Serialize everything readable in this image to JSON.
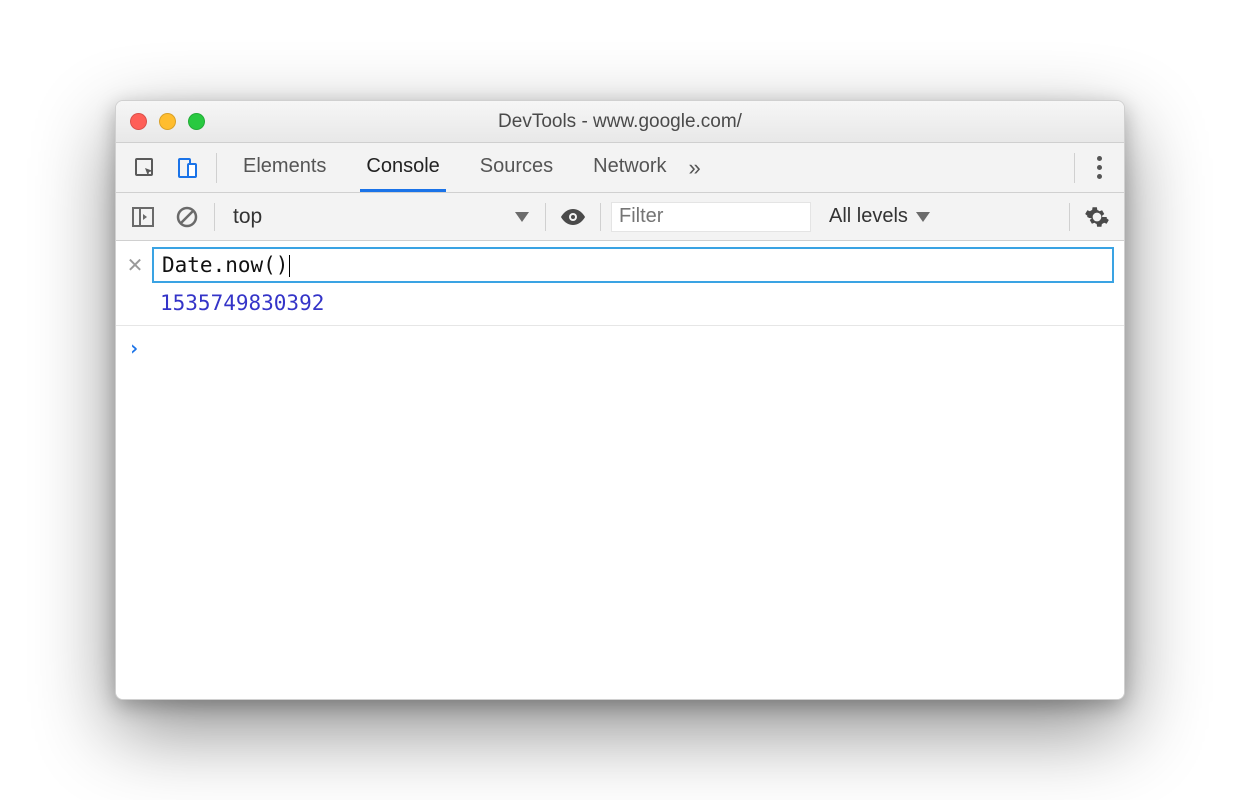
{
  "window": {
    "title": "DevTools - www.google.com/"
  },
  "tabs": {
    "items": [
      "Elements",
      "Console",
      "Sources",
      "Network"
    ],
    "active": "Console",
    "overflow_glyph": "»"
  },
  "subbar": {
    "context": "top",
    "filter_placeholder": "Filter",
    "filter_value": "",
    "levels_label": "All levels"
  },
  "console": {
    "live_expression": "Date.now()",
    "live_result": "1535749830392",
    "prompt_value": ""
  },
  "icons": {
    "inspect": "inspect-icon",
    "device": "device-icon",
    "sidebar": "sidebar-toggle-icon",
    "clear": "clear-icon",
    "eye": "eye-icon",
    "gear": "gear-icon",
    "kebab": "kebab-icon",
    "close": "close-icon"
  }
}
